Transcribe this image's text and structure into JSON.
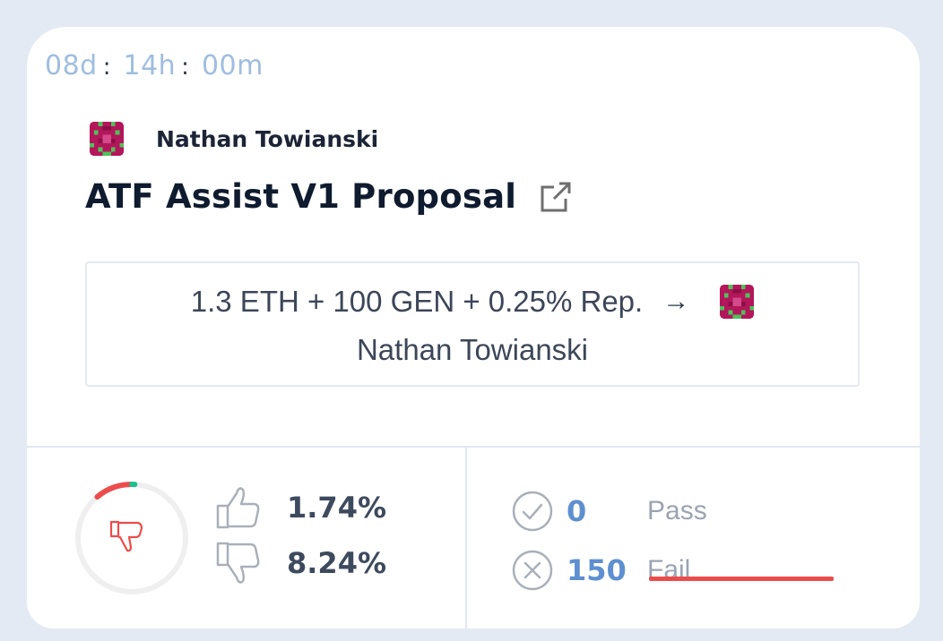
{
  "countdown": {
    "days": "08d",
    "hours": "14h",
    "minutes": "00m",
    "separator": ":"
  },
  "proposal": {
    "author": "Nathan Towianski",
    "title": "ATF Assist V1 Proposal"
  },
  "reward": {
    "amounts": "1.3 ETH + 100 GEN + 0.25% Rep.",
    "arrow": "→",
    "beneficiary": "Nathan Towianski"
  },
  "votes": {
    "for_pct": "1.74%",
    "against_pct": "8.24%",
    "gauge_for_fraction": 0.0174,
    "gauge_against_fraction": 0.0824,
    "gauge_colors": {
      "against": "#ec4c4c",
      "for": "#1fbf8f",
      "track": "#efefef"
    }
  },
  "crowd": {
    "pass_count": "0",
    "pass_label": "Pass",
    "fail_count": "150",
    "fail_label": "Fail",
    "accent": "#ec4c4c"
  },
  "icons": {
    "avatar": "identicon-avatar-icon",
    "external": "external-link-icon",
    "thumbs_up": "thumbs-up-icon",
    "thumbs_down": "thumbs-down-icon",
    "check": "check-circle-icon",
    "cross": "x-circle-icon"
  }
}
